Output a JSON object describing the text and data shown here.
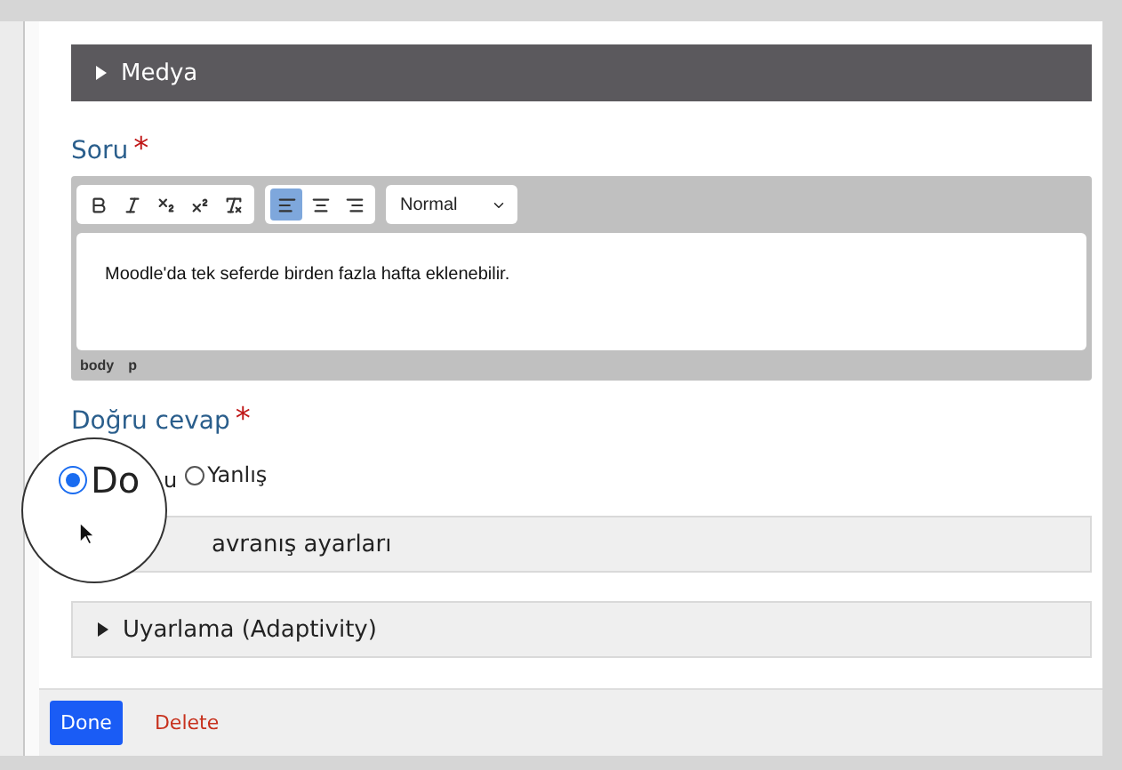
{
  "media_section": {
    "label": "Medya",
    "expanded": false
  },
  "question": {
    "label": "Soru",
    "required_mark": "*",
    "editor": {
      "toolbar_groups": [
        [
          {
            "kind": "bold",
            "selected": false
          },
          {
            "kind": "italic",
            "selected": false
          },
          {
            "kind": "subscript",
            "selected": false
          },
          {
            "kind": "superscript",
            "selected": false
          },
          {
            "kind": "clear",
            "selected": false
          }
        ],
        [
          {
            "kind": "align-left",
            "selected": true
          },
          {
            "kind": "align-center",
            "selected": false
          },
          {
            "kind": "align-right",
            "selected": false
          }
        ]
      ],
      "format": "Normal",
      "text": "Moodle'da tek seferde birden fazla hafta eklenebilir.",
      "path": [
        "body",
        "p"
      ]
    }
  },
  "answer": {
    "label": "Doğru cevap",
    "required_mark": "*",
    "options": [
      {
        "label": "Do",
        "tail": "u",
        "selected": true
      },
      {
        "label": "Yanlış",
        "selected": false
      }
    ]
  },
  "sections": [
    {
      "label": "avranış ayarları",
      "kind": "covered"
    },
    {
      "label": "Uyarlama (Adaptivity)",
      "kind": "collapsible",
      "expanded": false
    }
  ],
  "footer": {
    "buttons": [
      {
        "label": "Done",
        "kind": "primary"
      },
      {
        "label": "Delete",
        "kind": "danger"
      }
    ]
  }
}
